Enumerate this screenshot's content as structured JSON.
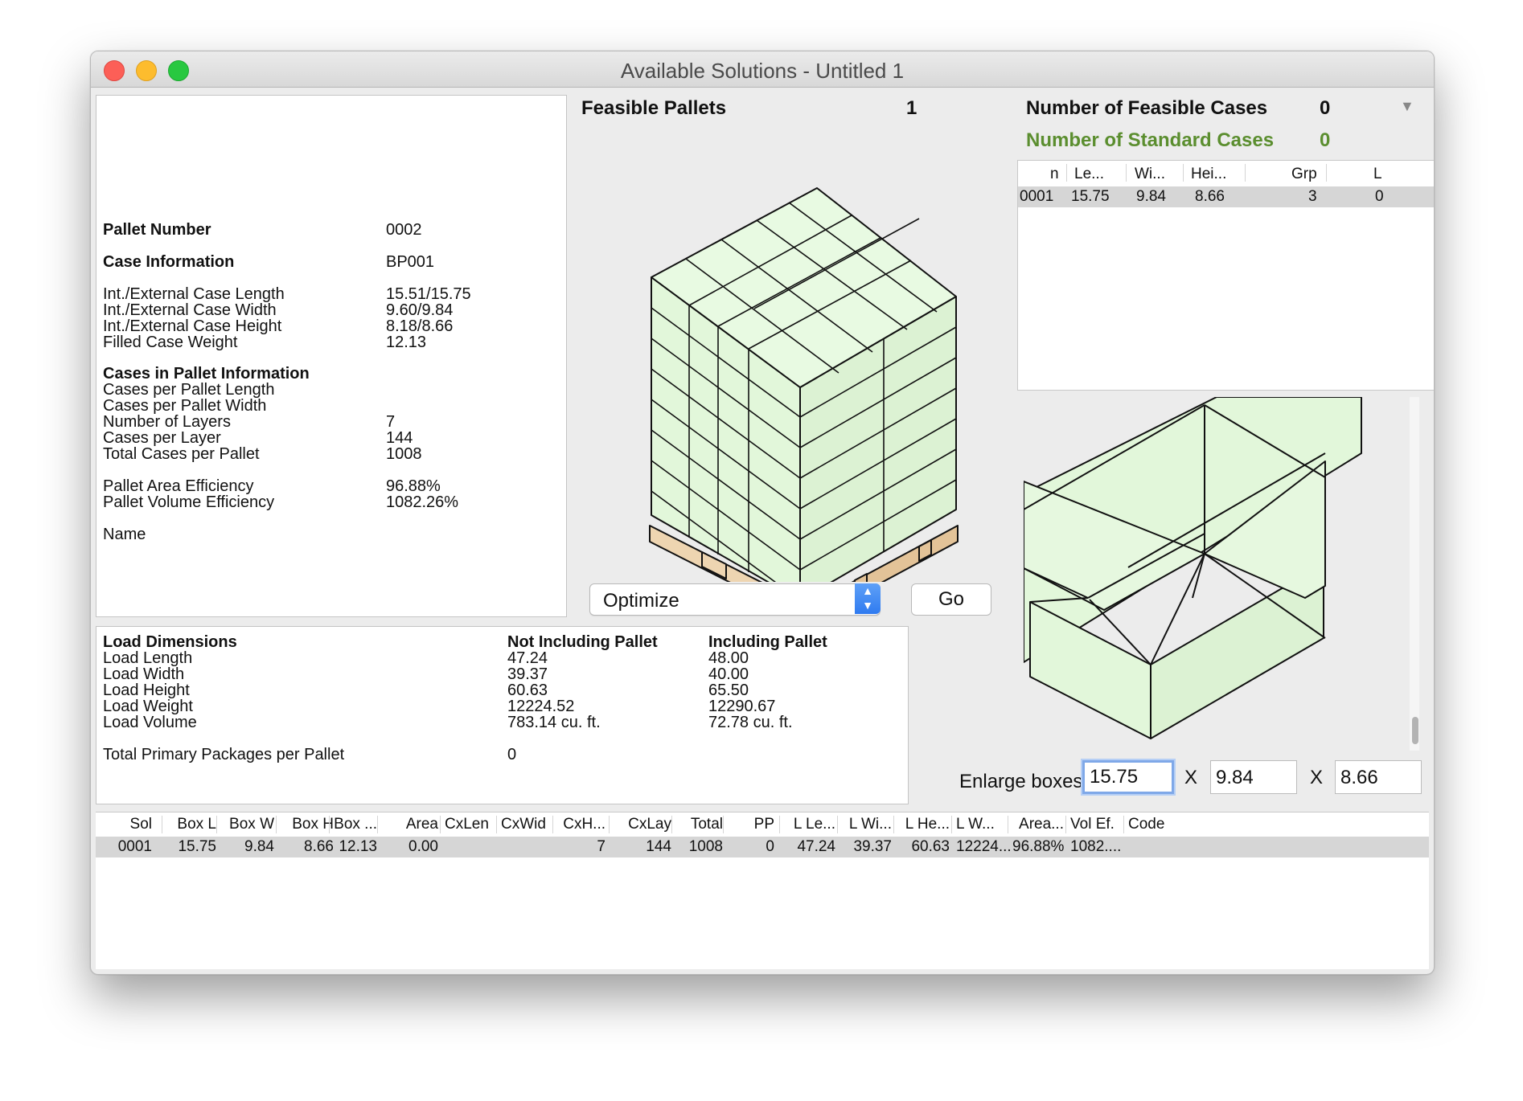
{
  "window": {
    "title": "Available Solutions - Untitled 1"
  },
  "info": {
    "pallet_number_label": "Pallet Number",
    "pallet_number": "0002",
    "case_info_label": "Case Information",
    "case_info": "BP001",
    "int_ext_length_label": "Int./External Case Length",
    "int_ext_length": "15.51/15.75",
    "int_ext_width_label": "Int./External Case Width",
    "int_ext_width": "9.60/9.84",
    "int_ext_height_label": "Int./External Case Height",
    "int_ext_height": "8.18/8.66",
    "filled_weight_label": "Filled Case Weight",
    "filled_weight": "12.13",
    "cases_in_pallet_label": "Cases in Pallet Information",
    "cases_per_length_label": "Cases per Pallet Length",
    "cases_per_width_label": "Cases per Pallet Width",
    "num_layers_label": "Number of Layers",
    "num_layers": "7",
    "cases_per_layer_label": "Cases per Layer",
    "cases_per_layer": "144",
    "total_cases_label": "Total Cases per Pallet",
    "total_cases": "1008",
    "area_eff_label": "Pallet Area Efficiency",
    "area_eff": "96.88%",
    "vol_eff_label": "Pallet Volume Efficiency",
    "vol_eff": "1082.26%",
    "name_label": "Name"
  },
  "load": {
    "header": "Load Dimensions",
    "col_not_incl": "Not Including Pallet",
    "col_incl": "Including Pallet",
    "rows": [
      {
        "label": "Load Length",
        "not_incl": "47.24",
        "incl": "48.00"
      },
      {
        "label": "Load Width",
        "not_incl": "39.37",
        "incl": "40.00"
      },
      {
        "label": "Load Height",
        "not_incl": "60.63",
        "incl": "65.50"
      },
      {
        "label": "Load Weight",
        "not_incl": "12224.52",
        "incl": "12290.67"
      },
      {
        "label": "Load Volume",
        "not_incl": "783.14 cu. ft.",
        "incl": "72.78 cu. ft."
      }
    ],
    "total_pp_label": "Total Primary Packages per Pallet",
    "total_pp": "0"
  },
  "feasible": {
    "label": "Feasible Pallets",
    "count": "1"
  },
  "optimize": {
    "selected": "Optimize",
    "go_label": "Go"
  },
  "counts": {
    "feasible_cases_label": "Number of Feasible Cases",
    "feasible_cases": "0",
    "standard_cases_label": "Number of Standard Cases",
    "standard_cases": "0"
  },
  "cases_table": {
    "headers": [
      "n",
      "Le...",
      "Wi...",
      "Hei...",
      "Grp",
      "L"
    ],
    "row": [
      "0001",
      "15.75",
      "9.84",
      "8.66",
      "3",
      "0"
    ]
  },
  "enlarge": {
    "label": "Enlarge boxes",
    "x_sep": "X",
    "l": "15.75",
    "w": "9.84",
    "h": "8.66"
  },
  "solutions": {
    "headers": [
      "Sol",
      "Box L",
      "Box W",
      "Box H",
      "Box ...",
      "Area",
      "CxLen",
      "CxWid",
      "CxH...",
      "CxLay",
      "Total",
      "PP",
      "L Le...",
      "L Wi...",
      "L He...",
      "L W...",
      "Area...",
      "Vol Ef.",
      "Code"
    ],
    "row": [
      "0001",
      "15.75",
      "9.84",
      "8.66",
      "12.13",
      "0.00",
      "",
      "",
      "7",
      "144",
      "1008",
      "0",
      "47.24",
      "39.37",
      "60.63",
      "12224...",
      "96.88%",
      "1082....",
      ""
    ]
  },
  "colors": {
    "case_fill": "#e2f7da",
    "pallet_wood": "#eed5b1",
    "standard_green": "#5b8e2f",
    "selection": "#d6d6d6"
  },
  "icons": [
    "close-icon",
    "minimize-icon",
    "zoom-icon",
    "popup-arrows-icon",
    "menu-triangle-icon"
  ]
}
